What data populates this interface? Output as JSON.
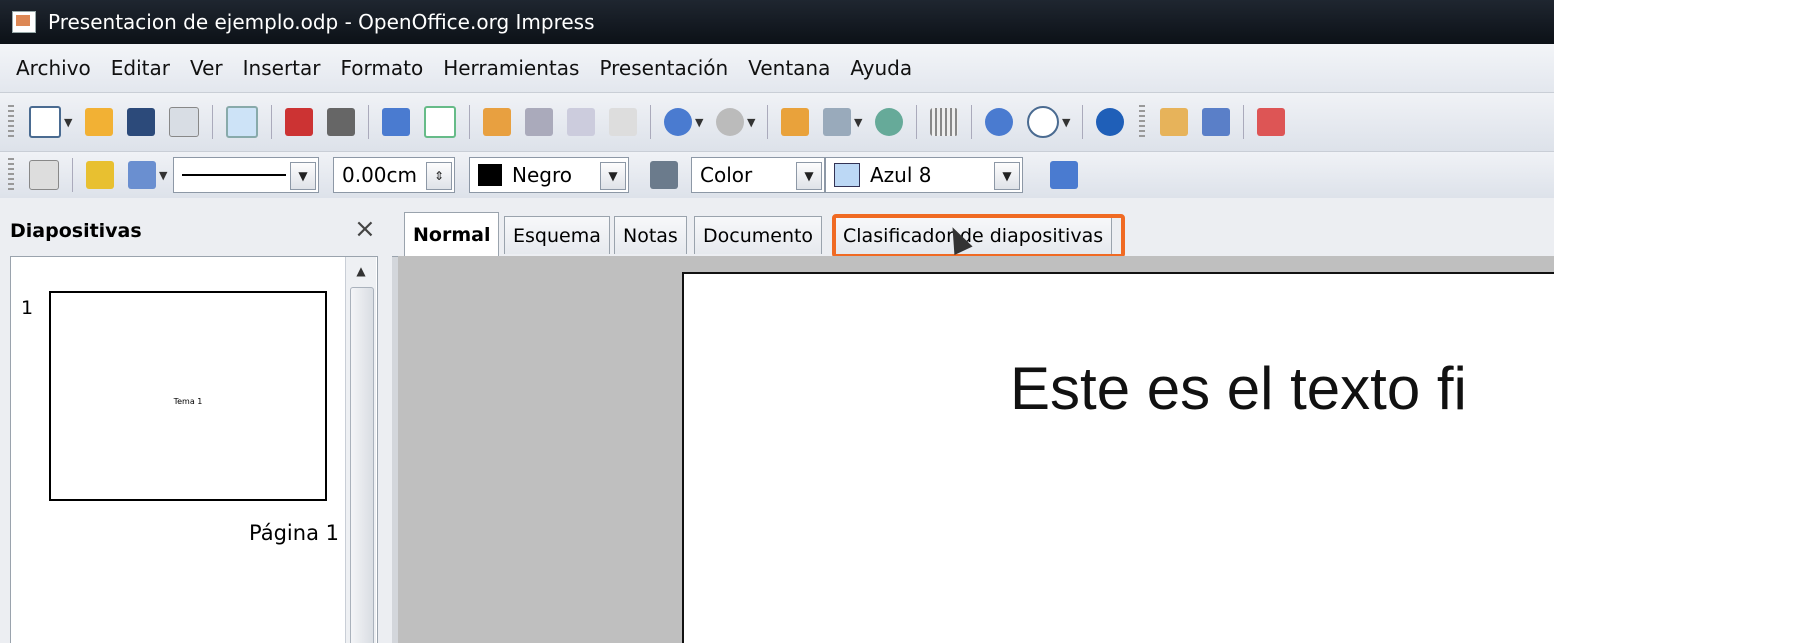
{
  "window": {
    "title": "Presentacion de ejemplo.odp - OpenOffice.org Impress"
  },
  "menu": [
    "Archivo",
    "Editar",
    "Ver",
    "Insertar",
    "Formato",
    "Herramientas",
    "Presentación",
    "Ventana",
    "Ayuda"
  ],
  "toolbar2": {
    "line_width": "0.00cm",
    "line_color": "Negro",
    "area_style": "Color",
    "area_fill": "Azul 8",
    "line_color_swatch": "#000000",
    "area_fill_swatch": "#bcd8f5"
  },
  "slides_panel": {
    "title": "Diapositivas",
    "close": "×",
    "slide_number": "1",
    "thumb_text": "Tema 1",
    "page_label": "Página 1"
  },
  "view_tabs": [
    "Normal",
    "Esquema",
    "Notas",
    "Documento",
    "Clasificador de diapositivas"
  ],
  "slide": {
    "text": "Este es el texto fi"
  },
  "icons": [
    "new-icon",
    "open-icon",
    "save-icon",
    "email-icon",
    "edit-file-icon",
    "pdf-icon",
    "print-icon",
    "spellcheck-icon",
    "autospell-icon",
    "cut-icon",
    "copy-icon",
    "paste-icon",
    "clone-format-icon",
    "undo-icon",
    "redo-icon",
    "chart-icon",
    "table-icon",
    "fontwork-icon",
    "grid-icon",
    "navigator-icon",
    "zoom-icon",
    "help-icon",
    "slide-show-icon"
  ]
}
